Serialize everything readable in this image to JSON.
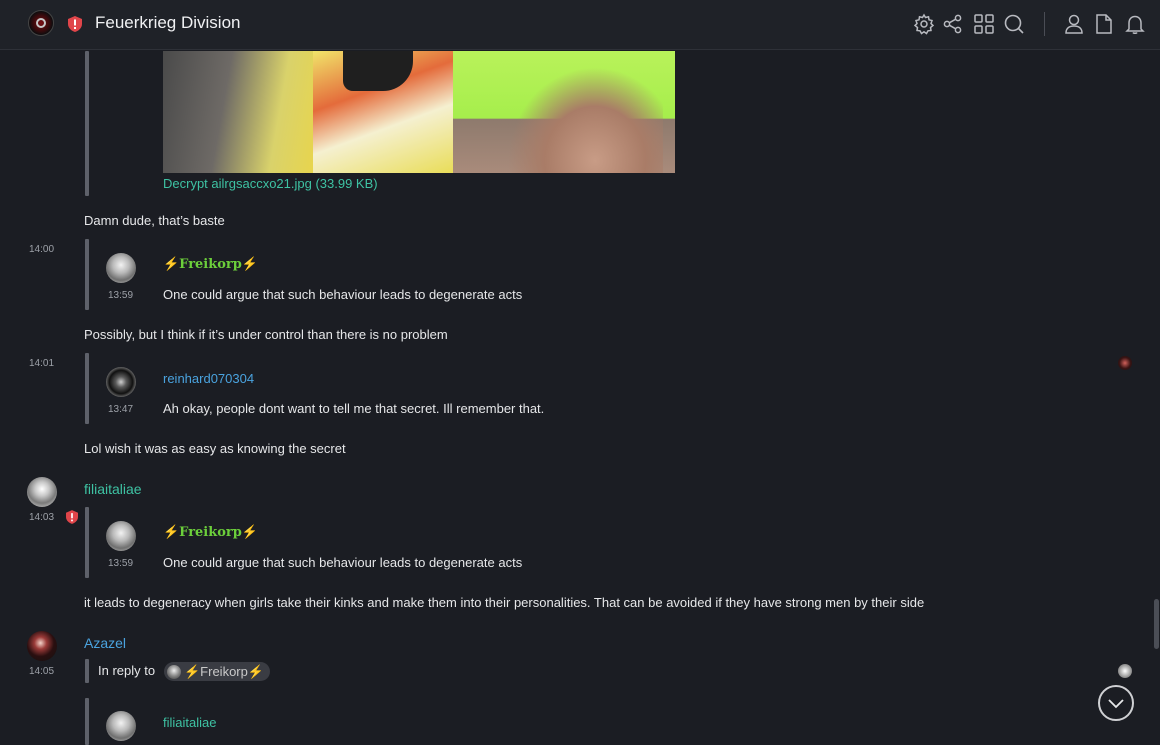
{
  "header": {
    "room_title": "Feuerkrieg Division",
    "icons": [
      "settings-icon",
      "share-icon",
      "grid-icon",
      "search-icon",
      "person-icon",
      "file-icon",
      "bell-icon"
    ]
  },
  "colors": {
    "accent_green": "#3ec2a3",
    "accent_blue": "#4aa3df",
    "badge_red": "#e0454a",
    "background": "#1b1d23"
  },
  "attachment": {
    "file_label": "Decrypt ailrgsaccxo21.jpg (33.99 KB)"
  },
  "messages": [
    {
      "text": "Damn dude, that’s baste"
    },
    {
      "time": "14:00",
      "quote": {
        "sender": "⚡Freikorp⚡",
        "time": "13:59",
        "text": "One could argue that such behaviour leads to degenerate acts"
      },
      "text": "Possibly, but I think if it’s under control than there is no problem"
    },
    {
      "time": "14:01",
      "quote": {
        "sender": "reinhard070304",
        "time": "13:47",
        "text": "Ah okay, people dont want to tell me that secret. Ill remember that."
      },
      "text": "Lol wish it was as easy as knowing the secret"
    },
    {
      "sender": "filiaitaliae",
      "time": "14:03",
      "quote": {
        "sender": "⚡Freikorp⚡",
        "time": "13:59",
        "text": "One could argue that such behaviour leads to degenerate acts"
      },
      "text": "it leads to degeneracy when girls take their kinks and make them into their personalities. That can be avoided if they have strong men by their side"
    },
    {
      "sender": "Azazel",
      "time": "14:05",
      "reply_label": "In reply to",
      "reply_to": "⚡Freikorp⚡",
      "quote": {
        "sender": "filiaitaliae"
      }
    }
  ]
}
